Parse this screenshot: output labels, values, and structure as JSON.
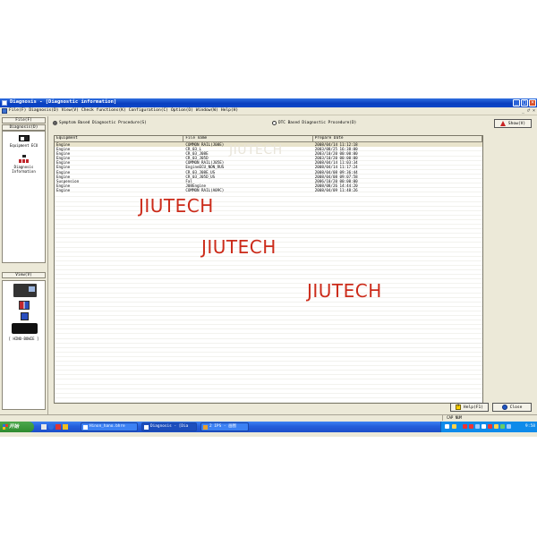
{
  "window": {
    "title": "Diagnosis - [Diagnostic information]",
    "buttons": [
      "_",
      "□",
      "×"
    ]
  },
  "menu": {
    "items": [
      "File(F)",
      "Diagnosis(D)",
      "View(V)",
      "Check functions(K)",
      "Configuration(C)",
      "Option(O)",
      "Window(W)",
      "Help(H)"
    ],
    "mdi_controls": "_ ♂ ×"
  },
  "left_panel": {
    "file_button": "File(F)",
    "diagnosis_button": "Diagnosis(D)",
    "items": [
      {
        "label": "Equipment ECU",
        "icon": "ecu-icon"
      },
      {
        "label": "Diagnosis Information",
        "icon": "diagnosis-info-icon"
      }
    ],
    "view_button": "View(V)",
    "device_label": "[ HINO-BOWIE ]"
  },
  "main": {
    "symptom_radio": "Symptom Based Diagnostic Procedure(S)",
    "dtc_radio": "DTC Based Diagnostic Procedure(D)",
    "show_button": "Show(V)",
    "columns": [
      "Equipment",
      "File name",
      "Prepare Date"
    ],
    "rows": [
      {
        "equipment": "Engine",
        "file": "COMMON RAIL(J08E)",
        "date": "2008/04/14 11:12:18"
      },
      {
        "equipment": "Engine",
        "file": "CR_03_L",
        "date": "2003/08/25 16:38:00"
      },
      {
        "equipment": "Engine",
        "file": "CR_03_J08E",
        "date": "2003/10/20 00:00:00"
      },
      {
        "equipment": "Engine",
        "file": "CR_03_J05D",
        "date": "2003/10/20 00:00:00"
      },
      {
        "equipment": "Engine",
        "file": "COMMON RAIL(J05E)",
        "date": "2008/04/14 11:03:34"
      },
      {
        "equipment": "Engine",
        "file": "EngineECU_NON_RUS",
        "date": "2008/04/14 11:17:24"
      },
      {
        "equipment": "Engine",
        "file": "CR_03_J08E_US",
        "date": "2008/04/08 09:36:44"
      },
      {
        "equipment": "Engine",
        "file": "CR_03_J05D_US",
        "date": "2008/04/08 09:07:58"
      },
      {
        "equipment": "Suspension",
        "file": "Fal",
        "date": "2006/10/20 00:00:00"
      },
      {
        "equipment": "Engine",
        "file": "J08Engine",
        "date": "2008/08/26 14:44:20"
      },
      {
        "equipment": "Engine",
        "file": "COMMON RAIL(A09C)",
        "date": "2008/04/09 11:48:26"
      }
    ],
    "help_button": "Help(F1)",
    "close_button": "Close"
  },
  "status": {
    "cap": "CAP NUM"
  },
  "taskbar": {
    "start": "开始",
    "tasks": [
      "Hinon_hano.bhre",
      "Diagnosis - [Dia",
      "2 IPS - 画图"
    ],
    "clock": "9:58"
  },
  "watermarks": [
    "JIUTECH",
    "JIUTECH",
    "JIUTECH",
    "JIUTECH"
  ],
  "colors": {
    "titlebar": "#0a3fbf",
    "watermark": "#cc2b1a",
    "taskbar": "#245edb",
    "start": "#2e8b2e"
  }
}
